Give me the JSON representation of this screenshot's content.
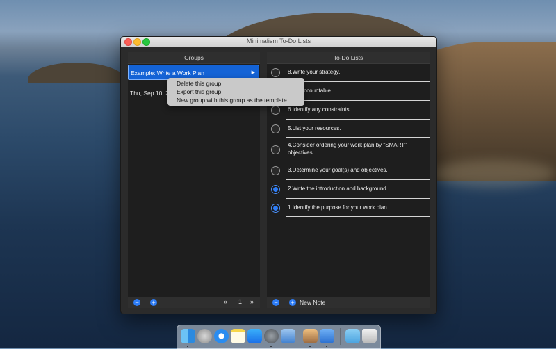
{
  "window": {
    "title": "Minimalism To-Do Lists"
  },
  "groups_panel": {
    "header": "Groups",
    "items": [
      {
        "label": "Example: Write a Work Plan",
        "selected": true,
        "arrow": "▶"
      },
      {
        "label": "Thu, Sep 10, 20",
        "selected": false
      }
    ],
    "pager": {
      "prev": "«",
      "page": "1",
      "next": "»"
    },
    "remove_symbol": "−",
    "add_symbol": "+"
  },
  "todo_panel": {
    "header": "To-Do Lists",
    "items": [
      {
        "text": "8.Write your strategy.",
        "done": false
      },
      {
        "text": "7.Be accountable.",
        "done": false
      },
      {
        "text": "6.Identify any constraints.",
        "done": false
      },
      {
        "text": "5.List your resources.",
        "done": false
      },
      {
        "text": "4.Consider ordering your work plan by \"SMART\" objectives.",
        "done": false
      },
      {
        "text": "3.Determine your goal(s) and objectives.",
        "done": false
      },
      {
        "text": "2.Write the introduction and background.",
        "done": true
      },
      {
        "text": "1.Identify the purpose for your work plan.",
        "done": true
      }
    ],
    "remove_symbol": "−",
    "add_symbol": "+",
    "new_note_label": "New Note"
  },
  "context_menu": {
    "items": [
      "Delete this group",
      "Export this group",
      "New group with this group as the template"
    ]
  },
  "colors": {
    "accent": "#2d7cf6",
    "selected": "#1463d6"
  },
  "dock": {
    "icons": [
      "finder-icon",
      "launchpad-icon",
      "safari-icon",
      "notes-icon",
      "app-store-icon",
      "system-preferences-icon",
      "preview-icon",
      "xcode-icon",
      "instruments-icon",
      "downloads-folder-icon",
      "trash-icon"
    ]
  }
}
